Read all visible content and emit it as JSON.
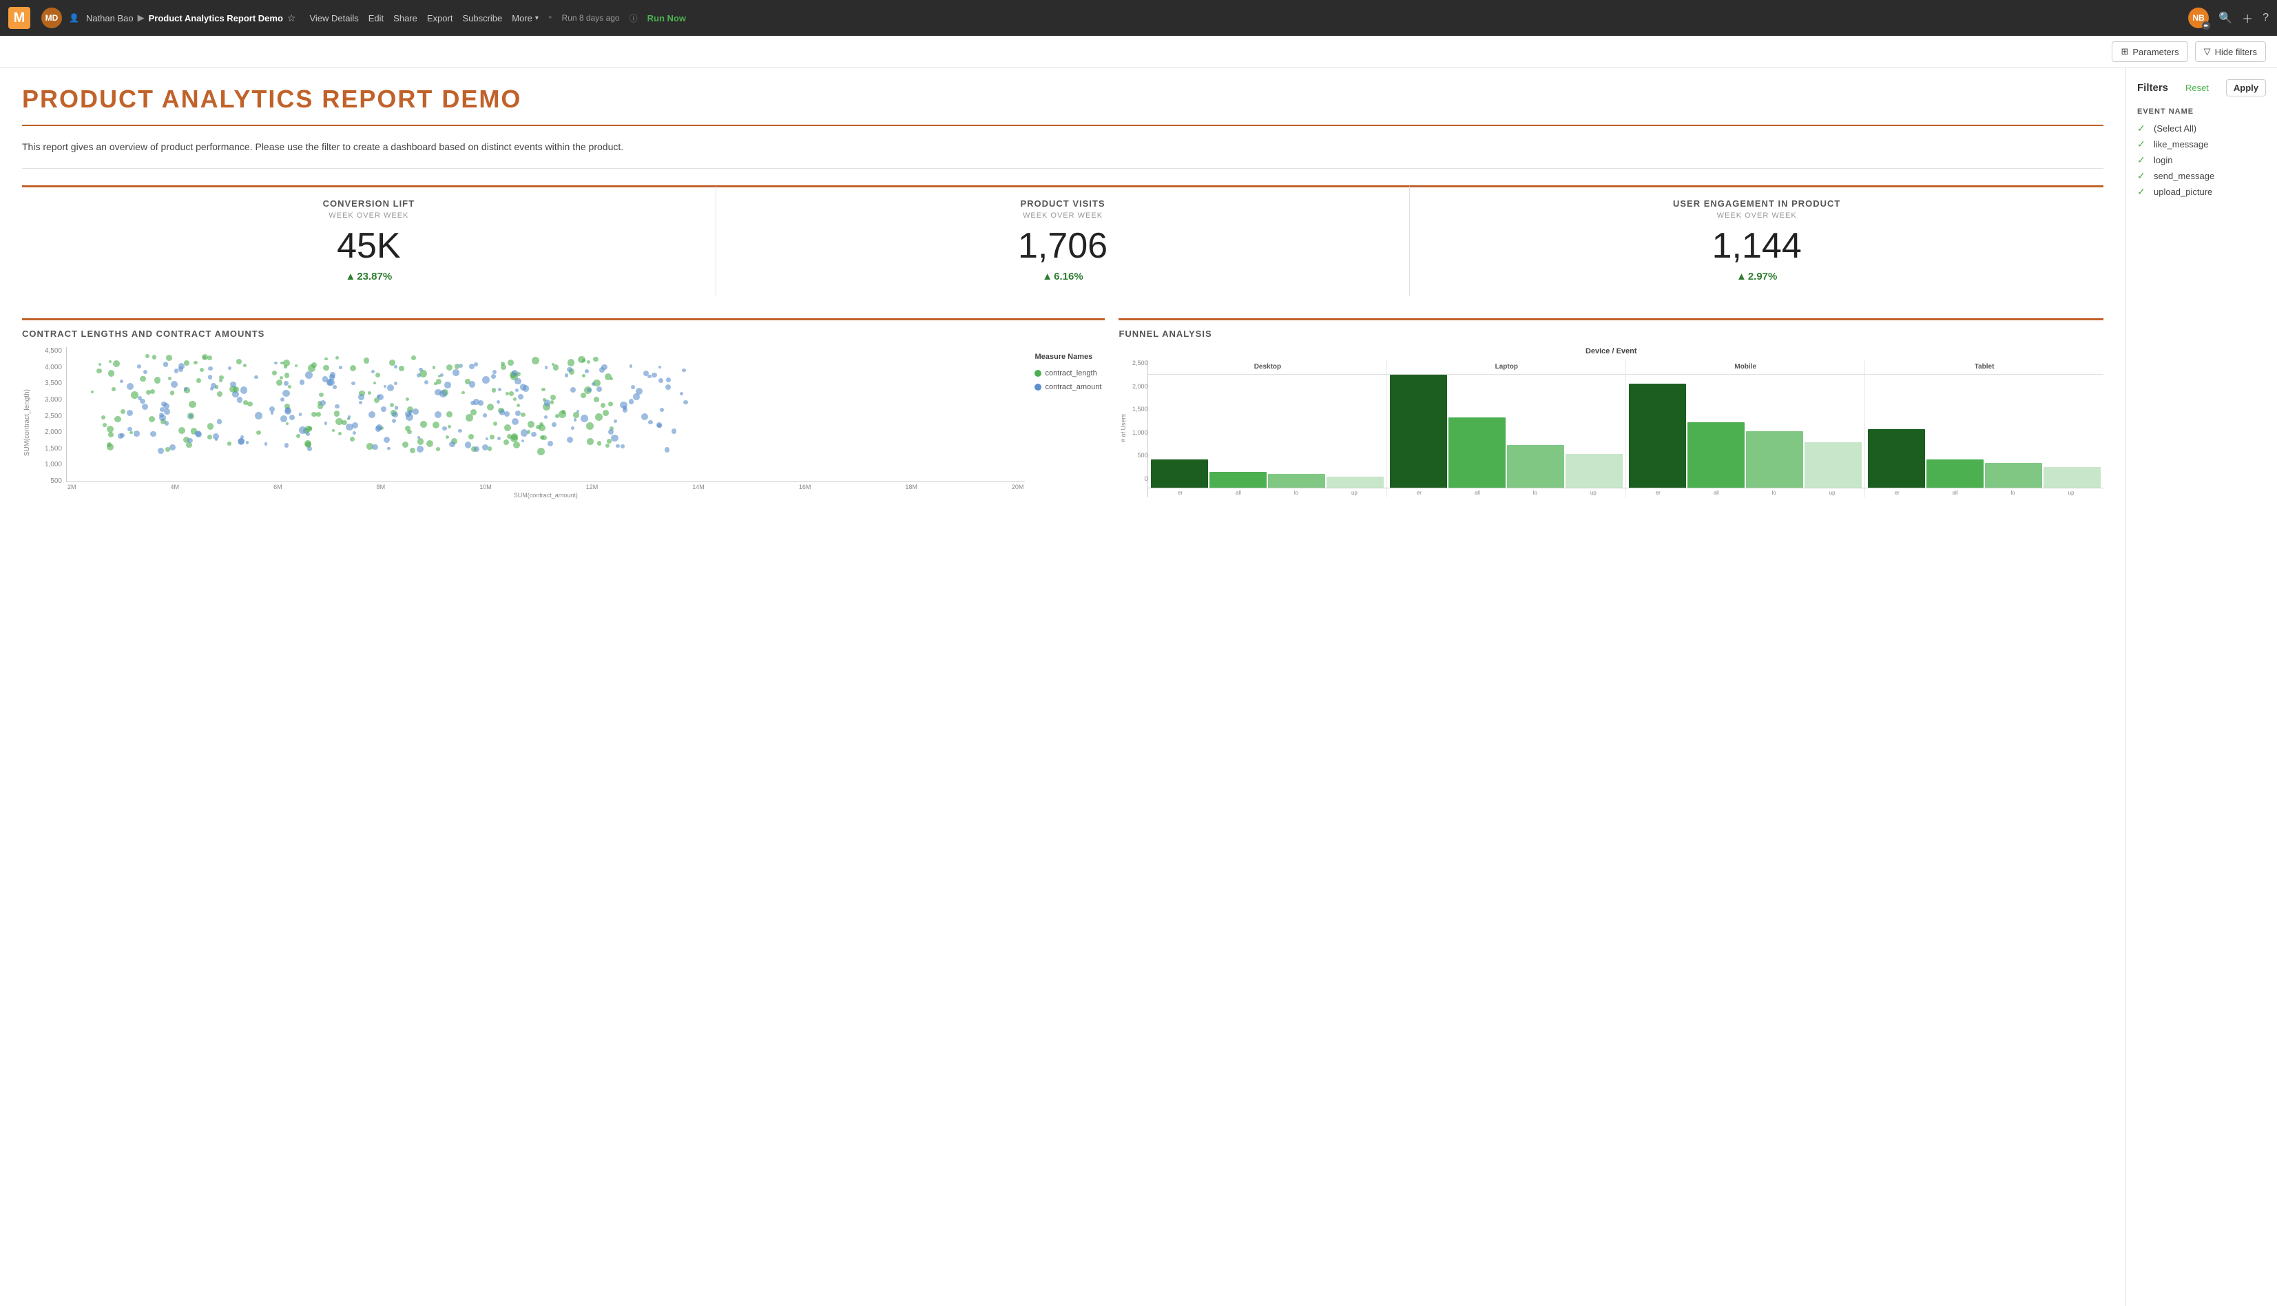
{
  "app": {
    "logo": "M",
    "avatar_initials": "MD",
    "user_name": "Nathan Bao",
    "report_breadcrumb_separator": "▶",
    "report_name": "Product Analytics Report Demo",
    "star_icon": "☆",
    "nav_actions": [
      {
        "label": "View Details",
        "id": "view-details"
      },
      {
        "label": "Edit",
        "id": "edit"
      },
      {
        "label": "Share",
        "id": "share"
      },
      {
        "label": "Export",
        "id": "export"
      },
      {
        "label": "Subscribe",
        "id": "subscribe"
      },
      {
        "label": "More",
        "id": "more"
      }
    ],
    "run_ago": "Run 8 days ago",
    "run_now": "Run Now",
    "right_avatar": "NB",
    "parameters_label": "Parameters",
    "hide_filters_label": "Hide filters"
  },
  "filters": {
    "title": "Filters",
    "reset_label": "Reset",
    "apply_label": "Apply",
    "section_title": "EVENT NAME",
    "items": [
      {
        "label": "(Select All)",
        "checked": true
      },
      {
        "label": "like_message",
        "checked": true
      },
      {
        "label": "login",
        "checked": true
      },
      {
        "label": "send_message",
        "checked": true
      },
      {
        "label": "upload_picture",
        "checked": true
      }
    ]
  },
  "report": {
    "title": "PRODUCT ANALYTICS REPORT DEMO",
    "description": "This report gives an overview of product performance. Please use the filter to create a dashboard based on distinct events within the product.",
    "metrics": [
      {
        "label": "CONVERSION LIFT",
        "sublabel": "WEEK OVER WEEK",
        "value": "45K",
        "change": "23.87%",
        "change_dir": "up"
      },
      {
        "label": "PRODUCT VISITS",
        "sublabel": "WEEK OVER WEEK",
        "value": "1,706",
        "change": "6.16%",
        "change_dir": "up"
      },
      {
        "label": "USER ENGAGEMENT IN PRODUCT",
        "sublabel": "WEEK OVER WEEK",
        "value": "1,144",
        "change": "2.97%",
        "change_dir": "up"
      }
    ],
    "scatter_chart": {
      "title": "CONTRACT LENGTHS AND CONTRACT AMOUNTS",
      "y_axis_label": "SUM(contract_length)",
      "x_axis_label": "SUM(contract_amount)",
      "y_ticks": [
        "4,500",
        "4,000",
        "3,500",
        "3,000",
        "2,500",
        "2,000",
        "1,500",
        "1,000",
        "500"
      ],
      "x_ticks": [
        "2,000,000",
        "4,000,000",
        "6,000,000",
        "8,000,000",
        "10,000,000",
        "12,000,000",
        "14,000,000",
        "16,000,000",
        "18,000,000",
        "20,000,000"
      ],
      "legend": {
        "title": "Measure Names",
        "items": [
          {
            "label": "contract_length",
            "color": "#4caf50"
          },
          {
            "label": "contract_amount",
            "color": "#5c8fcc"
          }
        ]
      }
    },
    "funnel_chart": {
      "title": "FUNNEL ANALYSIS",
      "header": "Device / Event",
      "y_label": "# of Users",
      "y_ticks": [
        "2,500",
        "2,000",
        "1,500",
        "1,000",
        "500",
        "0"
      ],
      "devices": [
        "Desktop",
        "Laptop",
        "Mobile",
        "Tablet"
      ],
      "events": [
        "er",
        "all",
        "lo",
        "up"
      ],
      "bars": {
        "Desktop": [
          {
            "height_pct": 25,
            "color": "#1b5e20"
          },
          {
            "height_pct": 14,
            "color": "#4caf50"
          },
          {
            "height_pct": 12,
            "color": "#81c784"
          },
          {
            "height_pct": 10,
            "color": "#c8e6c9"
          }
        ],
        "Laptop": [
          {
            "height_pct": 100,
            "color": "#1b5e20"
          },
          {
            "height_pct": 62,
            "color": "#4caf50"
          },
          {
            "height_pct": 38,
            "color": "#81c784"
          },
          {
            "height_pct": 30,
            "color": "#c8e6c9"
          }
        ],
        "Mobile": [
          {
            "height_pct": 92,
            "color": "#1b5e20"
          },
          {
            "height_pct": 58,
            "color": "#4caf50"
          },
          {
            "height_pct": 50,
            "color": "#81c784"
          },
          {
            "height_pct": 40,
            "color": "#c8e6c9"
          }
        ],
        "Tablet": [
          {
            "height_pct": 52,
            "color": "#1b5e20"
          },
          {
            "height_pct": 25,
            "color": "#4caf50"
          },
          {
            "height_pct": 22,
            "color": "#81c784"
          },
          {
            "height_pct": 18,
            "color": "#c8e6c9"
          }
        ]
      }
    }
  }
}
